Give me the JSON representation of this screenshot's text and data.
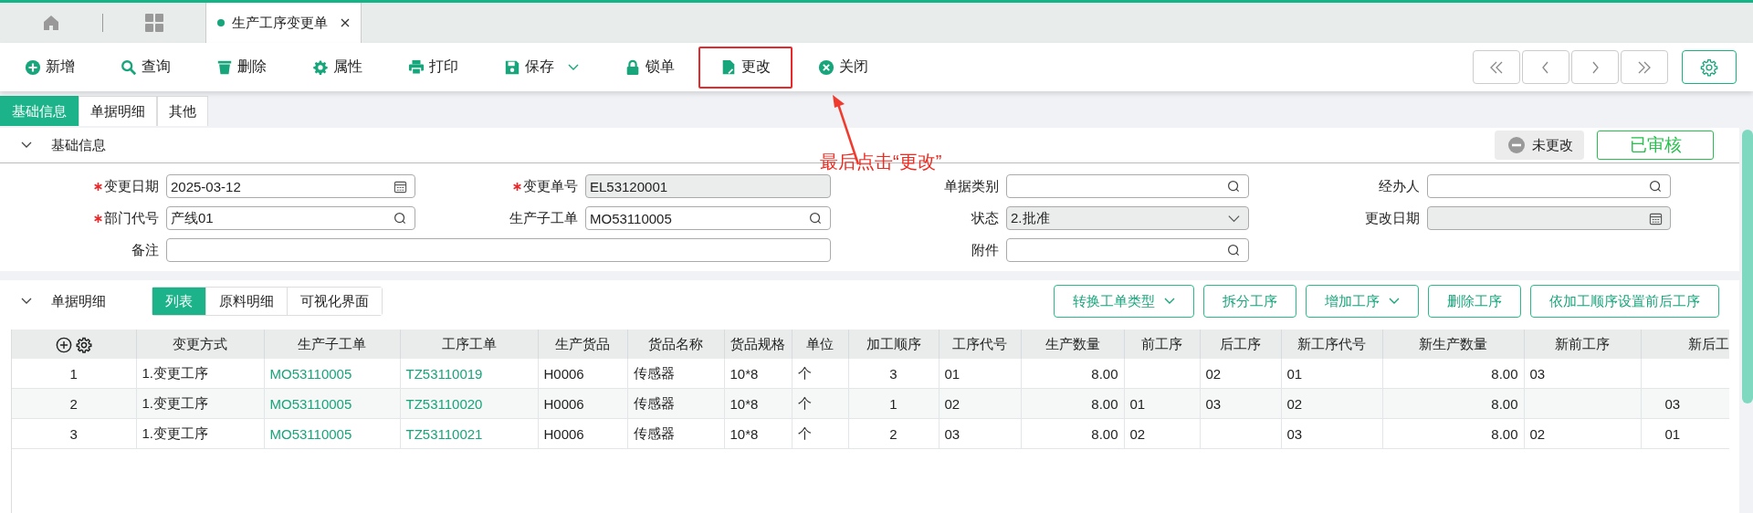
{
  "top_tabs": [
    {
      "label": "生产工序变更单",
      "selected": true,
      "closable": true
    }
  ],
  "toolbar": {
    "buttons": [
      {
        "label": "新增",
        "dropdown": false,
        "highlighted": false
      },
      {
        "label": "查询",
        "dropdown": false,
        "highlighted": false
      },
      {
        "label": "删除",
        "dropdown": false,
        "highlighted": false
      },
      {
        "label": "属性",
        "dropdown": false,
        "highlighted": false
      },
      {
        "label": "打印",
        "dropdown": false,
        "highlighted": false
      },
      {
        "label": "保存",
        "dropdown": true,
        "highlighted": false
      },
      {
        "label": "锁单",
        "dropdown": false,
        "highlighted": false
      },
      {
        "label": "更改",
        "dropdown": false,
        "highlighted": true
      },
      {
        "label": "关闭",
        "dropdown": false,
        "highlighted": false
      }
    ]
  },
  "form_tabs": [
    {
      "label": "基础信息",
      "selected": true
    },
    {
      "label": "单据明细",
      "selected": false
    },
    {
      "label": "其他",
      "selected": false
    }
  ],
  "basic_section": {
    "title": "基础信息",
    "expanded": true,
    "change_status": "未更改",
    "approval_stamp": "已审核",
    "fields": [
      {
        "label": "变更日期",
        "required": true,
        "kind": "date",
        "value": "2025-03-12",
        "disabled": false
      },
      {
        "label": "变更单号",
        "required": true,
        "kind": "text",
        "value": "EL53120001",
        "disabled": true
      },
      {
        "label": "单据类别",
        "required": false,
        "kind": "lookup",
        "disabled": false
      },
      {
        "label": "经办人",
        "required": false,
        "kind": "lookup",
        "disabled": false
      },
      {
        "label": "部门代号",
        "required": true,
        "kind": "lookup",
        "value": "产线01",
        "disabled": false
      },
      {
        "label": "生产子工单",
        "required": false,
        "kind": "lookup",
        "value": "MO53110005",
        "disabled": false
      },
      {
        "label": "状态",
        "required": false,
        "kind": "select",
        "value": "2.批准",
        "disabled": true
      },
      {
        "label": "更改日期",
        "required": false,
        "kind": "date",
        "disabled": true
      },
      {
        "label": "备注",
        "required": false,
        "kind": "memo",
        "disabled": false
      },
      {
        "label": "附件",
        "required": false,
        "kind": "lookup",
        "disabled": false
      }
    ]
  },
  "annotation": {
    "text": "最后点击“更改”"
  },
  "detail_section": {
    "title": "单据明细",
    "expanded": true,
    "view_tabs": [
      {
        "label": "列表",
        "selected": true
      },
      {
        "label": "原料明细",
        "selected": false
      },
      {
        "label": "可视化界面",
        "selected": false
      }
    ],
    "actions": [
      {
        "label": "转换工单类型",
        "dropdown": true
      },
      {
        "label": "拆分工序",
        "dropdown": false
      },
      {
        "label": "增加工序",
        "dropdown": true
      },
      {
        "label": "删除工序",
        "dropdown": false
      },
      {
        "label": "依加工顺序设置前后工序",
        "dropdown": false
      }
    ],
    "table": {
      "columns": [
        {
          "kind": "index"
        },
        {
          "label": "变更方式",
          "kind": "text"
        },
        {
          "label": "生产子工单",
          "kind": "link"
        },
        {
          "label": "工序工单",
          "kind": "link"
        },
        {
          "label": "生产货品",
          "kind": "text"
        },
        {
          "label": "货品名称",
          "kind": "text"
        },
        {
          "label": "货品规格",
          "kind": "text"
        },
        {
          "label": "单位",
          "kind": "text"
        },
        {
          "label": "加工顺序",
          "kind": "center"
        },
        {
          "label": "工序代号",
          "kind": "text"
        },
        {
          "label": "生产数量",
          "kind": "number"
        },
        {
          "label": "前工序",
          "kind": "text"
        },
        {
          "label": "后工序",
          "kind": "text"
        },
        {
          "label": "新工序代号",
          "kind": "text"
        },
        {
          "label": "新生产数量",
          "kind": "number"
        },
        {
          "label": "新前工序",
          "kind": "text"
        },
        {
          "label": "新后工",
          "kind": "cut"
        }
      ],
      "rows": [
        {
          "cells": [
            "1",
            "1.变更工序",
            "MO53110005",
            "TZ53110019",
            "H0006",
            "传感器",
            "10*8",
            "个",
            "3",
            "01",
            "8.00",
            null,
            "02",
            "01",
            "8.00",
            "03",
            null
          ]
        },
        {
          "cells": [
            "2",
            "1.变更工序",
            "MO53110005",
            "TZ53110020",
            "H0006",
            "传感器",
            "10*8",
            "个",
            "1",
            "02",
            "8.00",
            "01",
            "03",
            "02",
            "8.00",
            null,
            "03"
          ]
        },
        {
          "cells": [
            "3",
            "1.变更工序",
            "MO53110005",
            "TZ53110021",
            "H0006",
            "传感器",
            "10*8",
            "个",
            "2",
            "03",
            "8.00",
            "02",
            null,
            "03",
            "8.00",
            "02",
            "01"
          ]
        }
      ]
    }
  }
}
